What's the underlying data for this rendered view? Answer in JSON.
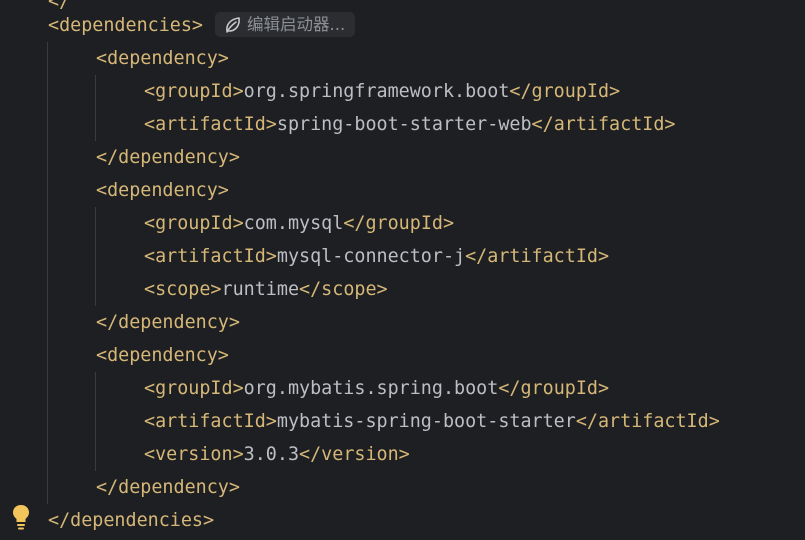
{
  "editor": {
    "hint": {
      "label": "编辑启动器...",
      "icon": "spring-leaf-icon"
    },
    "gutter_icon": "lightbulb-icon",
    "colors": {
      "background": "#1e1f22",
      "tag": "#d5b778",
      "text": "#bcbec4",
      "indent_guide": "#393b40"
    },
    "lines": [
      {
        "indent": 0,
        "open": "<dependencies>",
        "text": "",
        "close": ""
      },
      {
        "indent": 1,
        "open": "<dependency>",
        "text": "",
        "close": ""
      },
      {
        "indent": 2,
        "open": "<groupId>",
        "text": "org.springframework.boot",
        "close": "</groupId>"
      },
      {
        "indent": 2,
        "open": "<artifactId>",
        "text": "spring-boot-starter-web",
        "close": "</artifactId>"
      },
      {
        "indent": 1,
        "open": "</dependency>",
        "text": "",
        "close": ""
      },
      {
        "indent": 1,
        "open": "<dependency>",
        "text": "",
        "close": ""
      },
      {
        "indent": 2,
        "open": "<groupId>",
        "text": "com.mysql",
        "close": "</groupId>"
      },
      {
        "indent": 2,
        "open": "<artifactId>",
        "text": "mysql-connector-j",
        "close": "</artifactId>"
      },
      {
        "indent": 2,
        "open": "<scope>",
        "text": "runtime",
        "close": "</scope>"
      },
      {
        "indent": 1,
        "open": "</dependency>",
        "text": "",
        "close": ""
      },
      {
        "indent": 1,
        "open": "<dependency>",
        "text": "",
        "close": ""
      },
      {
        "indent": 2,
        "open": "<groupId>",
        "text": "org.mybatis.spring.boot",
        "close": "</groupId>"
      },
      {
        "indent": 2,
        "open": "<artifactId>",
        "text": "mybatis-spring-boot-starter",
        "close": "</artifactId>"
      },
      {
        "indent": 2,
        "open": "<version>",
        "text": "3.0.3",
        "close": "</version>"
      },
      {
        "indent": 1,
        "open": "</dependency>",
        "text": "",
        "close": ""
      },
      {
        "indent": 0,
        "open": "</dependencies>",
        "text": "",
        "close": ""
      }
    ]
  }
}
